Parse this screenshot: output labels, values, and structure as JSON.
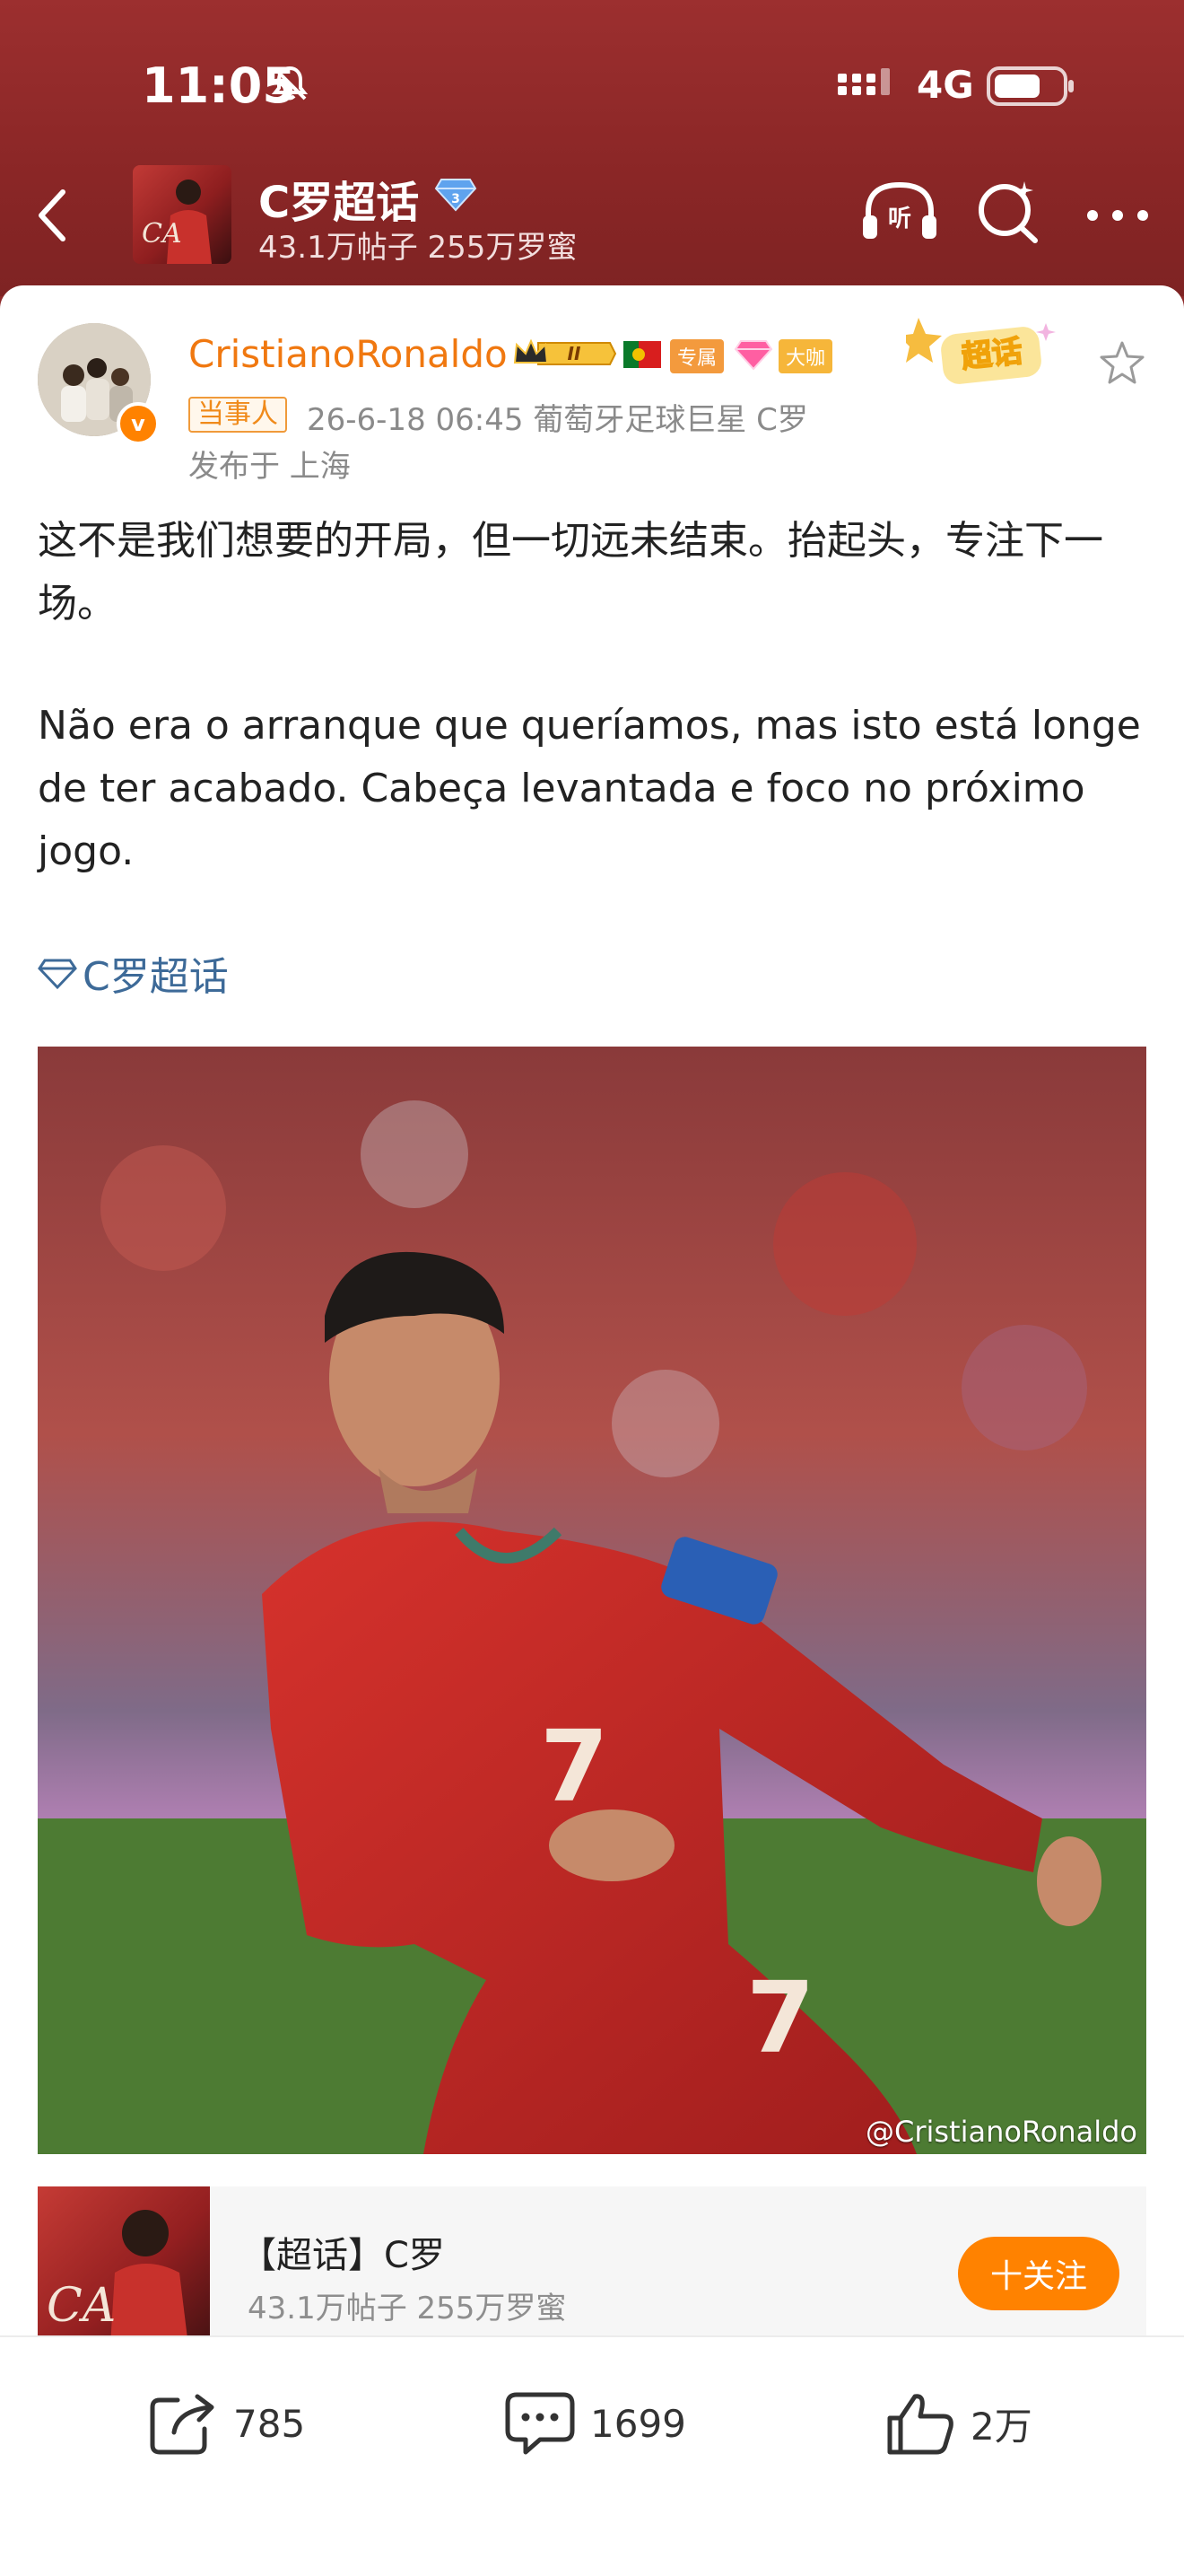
{
  "status": {
    "time": "11:05",
    "network": "4G"
  },
  "header": {
    "title": "C罗超话",
    "subtitle": "43.1万帖子 255万罗蜜"
  },
  "post": {
    "author": "CristianoRonaldo",
    "badges": {
      "exclusive": "专属",
      "bigshot": "大咖",
      "crown_level": "II"
    },
    "sticker": "超话",
    "role_tag": "当事人",
    "meta": "26-6-18 06:45  葡萄牙足球巨星 C罗",
    "location": "发布于 上海",
    "text_zh": "这不是我们想要的开局，但一切远未结束。抬起头，专注下一场。",
    "text_pt": "Não era o arranque que queríamos, mas isto está longe de ter acabado. Cabeça levantada e foco no próximo jogo.",
    "topic_link": "C罗超话",
    "image_watermark": "@CristianoRonaldo"
  },
  "topic_card": {
    "title": "【超话】C罗",
    "subtitle": "43.1万帖子 255万罗蜜",
    "follow_label": "十关注"
  },
  "actions": {
    "reposts": "785",
    "comments": "1699",
    "likes": "2万"
  },
  "colors": {
    "header_bg": "#8e2a2a",
    "author": "#f07810",
    "link": "#3d6a98",
    "follow": "#ff8200"
  }
}
